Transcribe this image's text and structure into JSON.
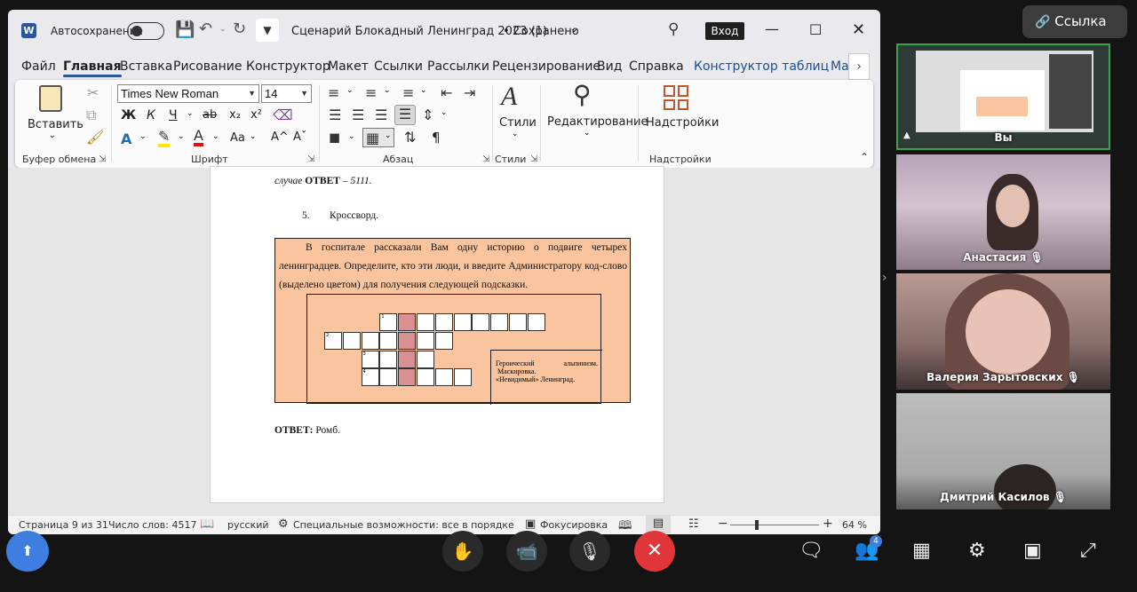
{
  "word": {
    "autosave_label": "Автосохранение",
    "doc_title": "Сценарий Блокадный Ленинград 2023 (1)",
    "saved_status": "• Сохранено",
    "signin": "Вход",
    "tabs": [
      "Файл",
      "Главная",
      "Вставка",
      "Рисование",
      "Конструктор",
      "Макет",
      "Ссылки",
      "Рассылки",
      "Рецензирование",
      "Вид",
      "Справка",
      "Конструктор таблиц",
      "Ма"
    ],
    "ribbon": {
      "paste": "Вставить",
      "clipboard": "Буфер обмена",
      "font_name": "Times New Roman",
      "font_size": "14",
      "font_group": "Шрифт",
      "bold": "Ж",
      "italic": "К",
      "underline": "Ч",
      "strike": "ab",
      "sub": "x₂",
      "sup": "x²",
      "case": "Aa",
      "grow": "A^",
      "shrink": "Aˇ",
      "paragraph_group": "Абзац",
      "pilcrow": "¶",
      "styles": "Стили",
      "styles_group": "Стили",
      "editing": "Редактирование",
      "addins": "Надстройки",
      "addins_group": "Надстройки"
    },
    "document": {
      "line1_italic": "случае",
      "line1_bold": "ОТВЕТ",
      "line1_rest": "– 5111.",
      "item_num": "5.",
      "item_title": "Кроссворд.",
      "paragraph": "В госпитале рассказали Вам одну историю о подвиге четырех ленинградцев. Определите, кто эти люди, и введите Администратору код-слово (выделено цветом) для получения следующей подсказки.",
      "cell_numbers": [
        "1",
        "2",
        "3",
        "4"
      ],
      "clue_lines": [
        "Героический альпинизм.",
        "Маскировка.",
        "«Невидимый» Ленинград."
      ],
      "answer_label": "ОТВЕТ:",
      "answer_value": "Ромб."
    },
    "status": {
      "page": "Страница 9 из 31",
      "words": "Число слов: 4517",
      "language": "русский",
      "accessibility": "Специальные возможности: все в порядке",
      "focus": "Фокусировка",
      "zoom": "64 %"
    }
  },
  "meeting": {
    "link_button": "Ссылка",
    "self_label": "Вы",
    "participants": [
      "Анастасия",
      "Валерия Зарытовских",
      "Дмитрий Касилов"
    ],
    "participants_count": "4"
  },
  "colors": {
    "accent": "#2b579a",
    "end_call": "#e0363a",
    "crossword_bg": "#f9c49e",
    "highlight": "#d99092"
  }
}
